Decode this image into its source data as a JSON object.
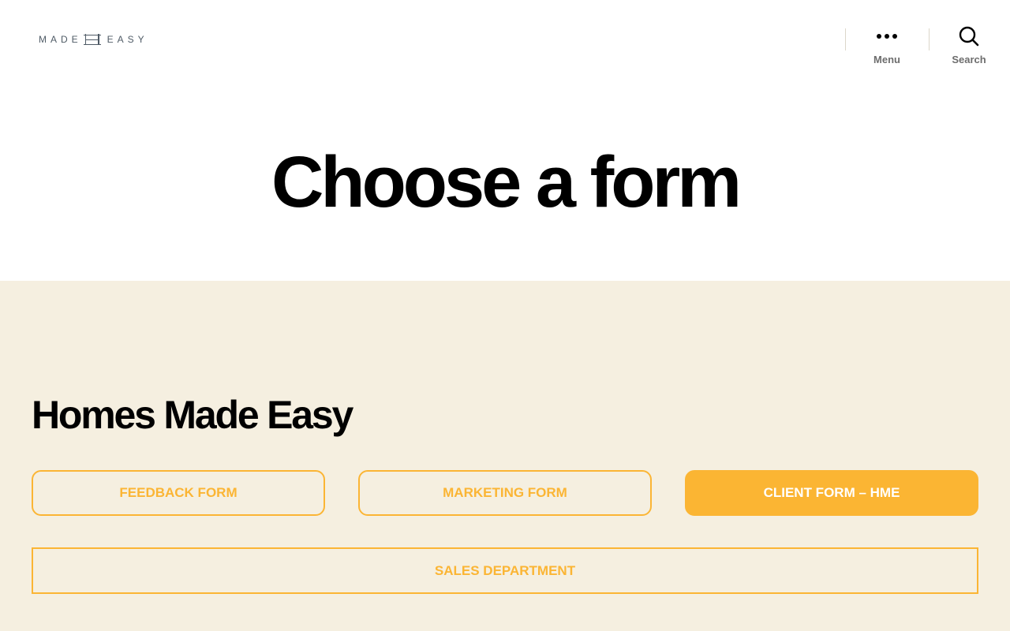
{
  "header": {
    "logo": {
      "left": "MADE",
      "right": "EASY"
    },
    "menu": {
      "label": "Menu",
      "icon": "ellipsis-icon"
    },
    "search": {
      "label": "Search",
      "icon": "search-icon"
    }
  },
  "page": {
    "title": "Choose a form"
  },
  "section": {
    "heading": "Homes Made Easy",
    "buttons": [
      {
        "label": "FEEDBACK FORM",
        "style": "outline"
      },
      {
        "label": "MARKETING FORM",
        "style": "outline"
      },
      {
        "label": "CLIENT FORM – HME",
        "style": "filled"
      },
      {
        "label": "SALES DEPARTMENT",
        "style": "outline"
      }
    ]
  },
  "colors": {
    "accent": "#fbb533",
    "section_bg": "#f5efe0",
    "text": "#000000"
  }
}
